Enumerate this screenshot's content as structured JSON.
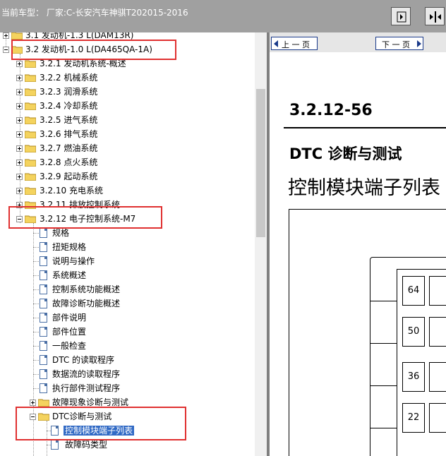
{
  "topbar": {
    "title": "当前车型：  厂家:C-长安汽车神骐T202015-2016",
    "buttons": [
      "collapse-pane-icon",
      "expand-pane-icon"
    ]
  },
  "tree": {
    "items": [
      {
        "label": "3.1 发动机-1.3 L(DAM13R)"
      },
      {
        "label": "3.2 发动机-1.0 L(DA465QA-1A)"
      },
      {
        "label": "3.2.1 发动机系统-概述"
      },
      {
        "label": "3.2.2 机械系统"
      },
      {
        "label": "3.2.3 润滑系统"
      },
      {
        "label": "3.2.4 冷却系统"
      },
      {
        "label": "3.2.5 进气系统"
      },
      {
        "label": "3.2.6 排气系统"
      },
      {
        "label": "3.2.7 燃油系统"
      },
      {
        "label": "3.2.8 点火系统"
      },
      {
        "label": "3.2.9 起动系统"
      },
      {
        "label": "3.2.10 充电系统"
      },
      {
        "label": "3.2.11 排放控制系统"
      },
      {
        "label": "3.2.12 电子控制系统-M7"
      },
      {
        "label": "规格"
      },
      {
        "label": "扭矩规格"
      },
      {
        "label": "说明与操作"
      },
      {
        "label": "系统概述"
      },
      {
        "label": "控制系统功能概述"
      },
      {
        "label": "故障诊断功能概述"
      },
      {
        "label": "部件说明"
      },
      {
        "label": "部件位置"
      },
      {
        "label": "一般检查"
      },
      {
        "label": "DTC 的读取程序"
      },
      {
        "label": "数据流的读取程序"
      },
      {
        "label": "执行部件测试程序"
      },
      {
        "label": "故障现象诊断与测试"
      },
      {
        "label": "DTC诊断与测试"
      },
      {
        "label": "控制模块端子列表"
      },
      {
        "label": "故障码类型"
      }
    ]
  },
  "nav": {
    "prev_label": "上 一 页",
    "next_label": "下 一 页"
  },
  "content": {
    "page_number": "3.2.12-56",
    "section_title": "DTC 诊断与测试",
    "subtitle": "控制模块端子列表",
    "pins": [
      "64",
      "50",
      "36",
      "22"
    ]
  }
}
